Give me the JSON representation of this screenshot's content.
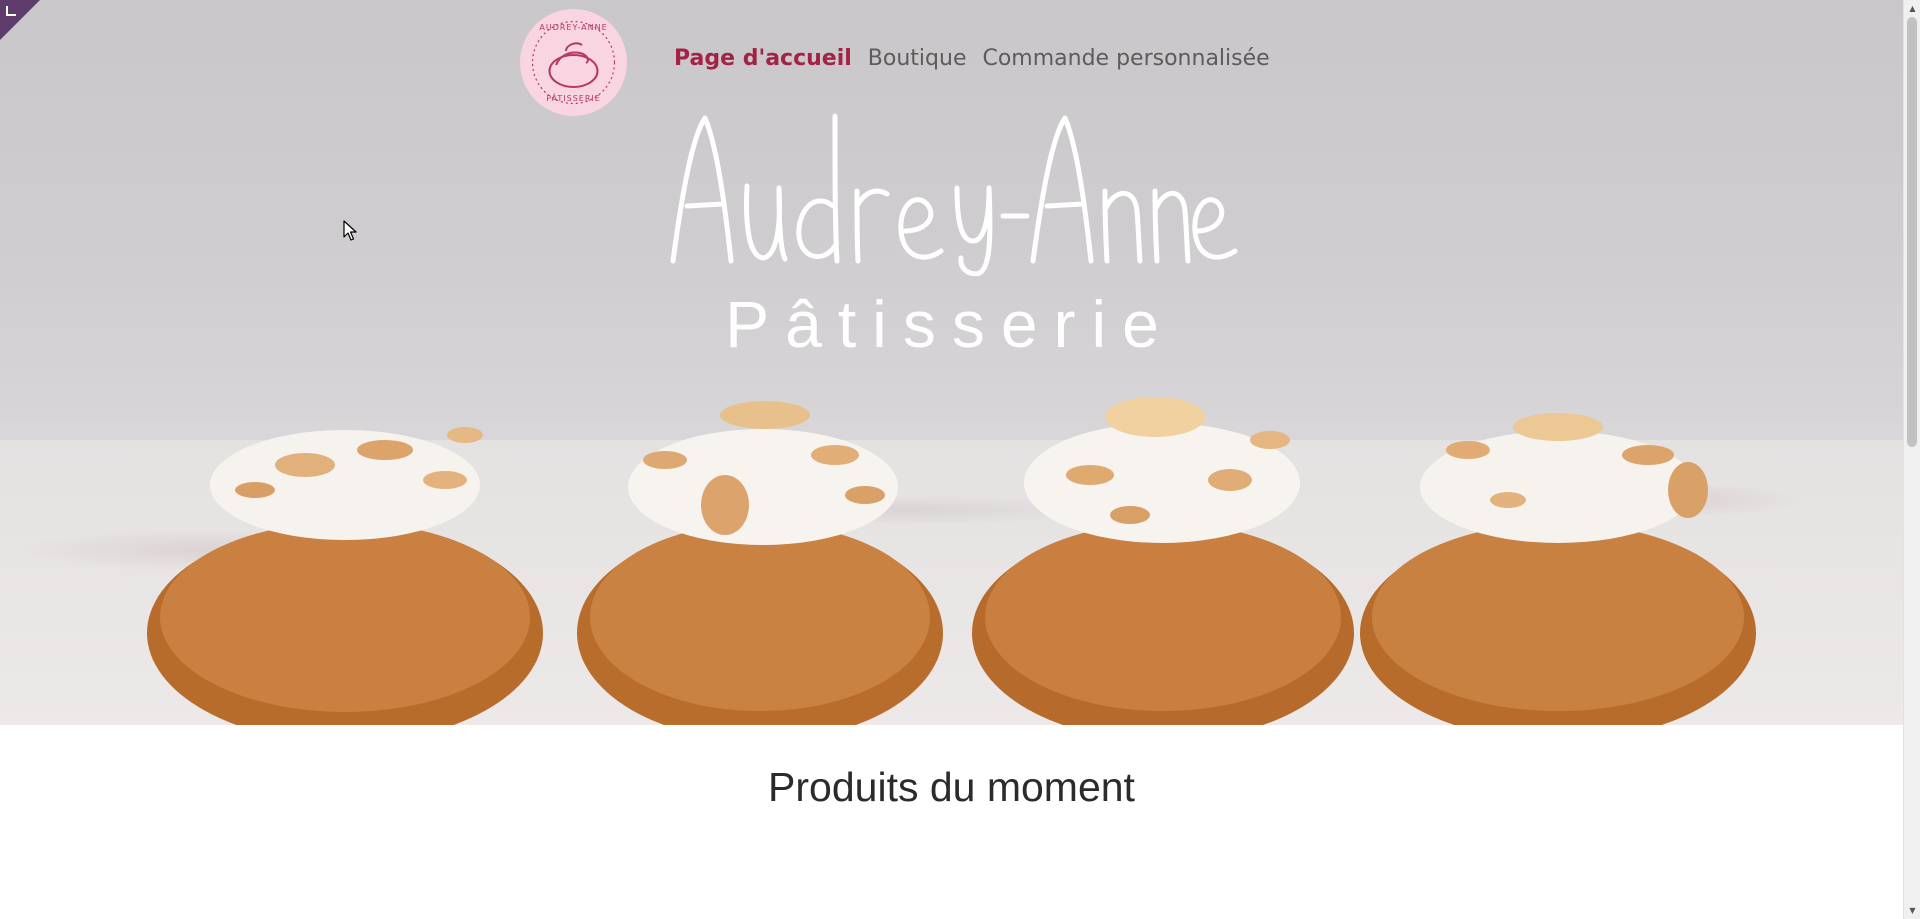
{
  "logo": {
    "top_text": "AUDREY-ANNE",
    "bottom_text": "PÂTISSERIE"
  },
  "nav": {
    "items": [
      {
        "label": "Page d'accueil",
        "active": true
      },
      {
        "label": "Boutique",
        "active": false
      },
      {
        "label": "Commande personnalisée",
        "active": false
      }
    ]
  },
  "hero": {
    "title": "Audrey-Anne",
    "subtitle": "Pâtisserie"
  },
  "section": {
    "title": "Produits du moment"
  },
  "colors": {
    "accent": "#a32346",
    "nav_text": "#5f5a5b",
    "logo_bg": "#f8d5e0",
    "corner": "#5d3b6a"
  }
}
